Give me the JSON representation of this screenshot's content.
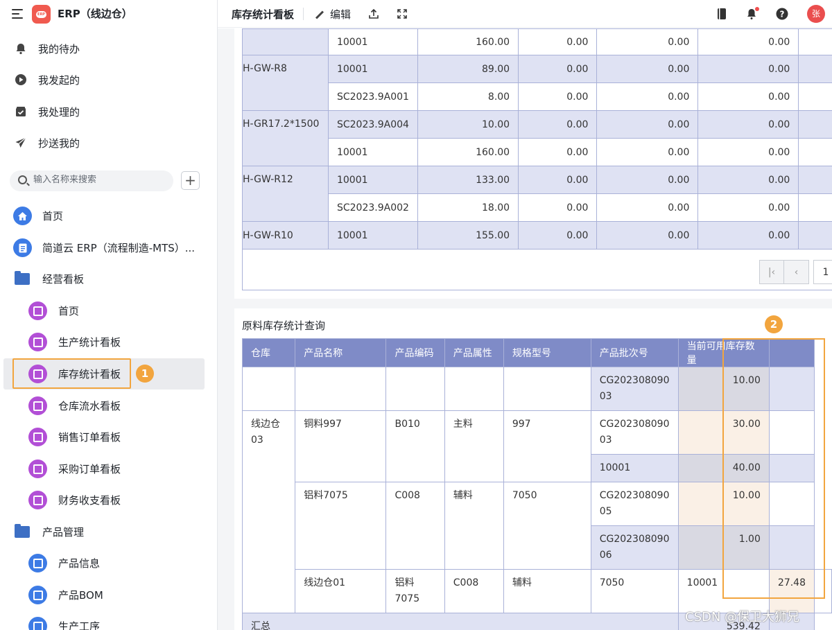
{
  "app": {
    "title": "ERP（线边仓）",
    "logo_text": "ERP"
  },
  "quick_links": [
    {
      "label": "我的待办",
      "icon": "bell-icon"
    },
    {
      "label": "我发起的",
      "icon": "play-circle-icon"
    },
    {
      "label": "我处理的",
      "icon": "inbox-check-icon"
    },
    {
      "label": "抄送我的",
      "icon": "send-icon"
    }
  ],
  "search": {
    "placeholder": "输入名称来搜索"
  },
  "nav": [
    {
      "label": "首页",
      "icon": "home-icon"
    },
    {
      "label": "简道云 ERP（流程制造-MTS）...",
      "icon": "document-icon"
    },
    {
      "label": "经营看板",
      "icon": "folder-icon"
    },
    {
      "label": "首页",
      "icon": "dashboard-icon"
    },
    {
      "label": "生产统计看板",
      "icon": "dashboard-icon"
    },
    {
      "label": "库存统计看板",
      "icon": "dashboard-icon",
      "active": true
    },
    {
      "label": "仓库流水看板",
      "icon": "dashboard-icon"
    },
    {
      "label": "销售订单看板",
      "icon": "dashboard-icon"
    },
    {
      "label": "采购订单看板",
      "icon": "dashboard-icon"
    },
    {
      "label": "财务收支看板",
      "icon": "dashboard-icon"
    },
    {
      "label": "产品管理",
      "icon": "folder-icon"
    },
    {
      "label": "产品信息",
      "icon": "form-icon"
    },
    {
      "label": "产品BOM",
      "icon": "hierarchy-icon"
    },
    {
      "label": "生产工序",
      "icon": "form-icon"
    }
  ],
  "annotations": {
    "one": "1",
    "two": "2"
  },
  "topbar": {
    "page_title": "库存统计看板",
    "edit_label": "编辑",
    "avatar": "张"
  },
  "table1": {
    "rows": [
      {
        "group": "",
        "batch": "10001",
        "v1": "160.00",
        "v2": "0.00",
        "v3": "0.00",
        "v4": "0.00"
      },
      {
        "group": "H-GW-R8",
        "batch": "10001",
        "v1": "89.00",
        "v2": "0.00",
        "v3": "0.00",
        "v4": "0.00"
      },
      {
        "group": "",
        "batch": "SC2023.9A001",
        "v1": "8.00",
        "v2": "0.00",
        "v3": "0.00",
        "v4": "0.00"
      },
      {
        "group": "H-GR17.2*1500",
        "batch": "SC2023.9A004",
        "v1": "10.00",
        "v2": "0.00",
        "v3": "0.00",
        "v4": "0.00"
      },
      {
        "group": "",
        "batch": "10001",
        "v1": "160.00",
        "v2": "0.00",
        "v3": "0.00",
        "v4": "0.00"
      },
      {
        "group": "H-GW-R12",
        "batch": "10001",
        "v1": "133.00",
        "v2": "0.00",
        "v3": "0.00",
        "v4": "0.00"
      },
      {
        "group": "",
        "batch": "SC2023.9A002",
        "v1": "18.00",
        "v2": "0.00",
        "v3": "0.00",
        "v4": "0.00"
      },
      {
        "group": "H-GW-R10",
        "batch": "10001",
        "v1": "155.00",
        "v2": "0.00",
        "v3": "0.00",
        "v4": "0.00"
      }
    ],
    "pager_page": "1"
  },
  "table2": {
    "title": "原料库存统计查询",
    "headers": [
      "仓库",
      "产品名称",
      "产品编码",
      "产品属性",
      "规格型号",
      "产品批次号",
      "当前可用库存数量"
    ],
    "rows": {
      "r0": {
        "batch": "CG202308090\n03",
        "qty": "10.00"
      },
      "r1": {
        "warehouse": "线边仓03",
        "name": "铜料997",
        "code": "B010",
        "attr": "主料",
        "spec": "997",
        "batch": "CG202308090\n03",
        "qty": "30.00"
      },
      "r2": {
        "batch": "10001",
        "qty": "40.00"
      },
      "r3": {
        "name": "铝料7075",
        "code": "C008",
        "attr": "辅料",
        "spec": "7050",
        "batch": "CG202308090\n05",
        "qty": "10.00"
      },
      "r4": {
        "batch": "CG202308090\n06",
        "qty": "1.00"
      },
      "r5": {
        "warehouse": "线边仓01",
        "name": "铝料7075",
        "code": "C008",
        "attr": "辅料",
        "spec": "7050",
        "batch": "10001",
        "qty": "27.48"
      }
    },
    "summary_label": "汇总",
    "summary_value": "539.42"
  },
  "watermark": "CSDN @保卫大狮兄"
}
